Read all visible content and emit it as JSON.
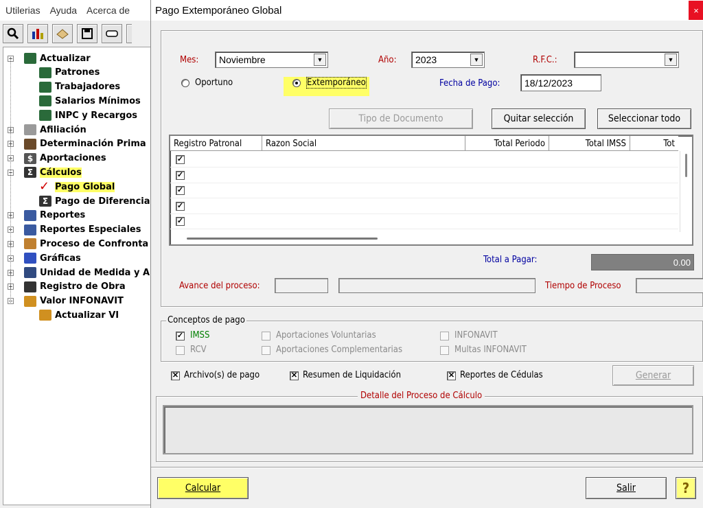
{
  "app": {
    "menu": [
      "Utilerias",
      "Ayuda",
      "Acerca de"
    ],
    "toolbar_icons": [
      "magnifier-icon",
      "chart-icon",
      "tools-icon",
      "save-icon",
      "button-icon",
      "more-icon"
    ],
    "tree": [
      {
        "label": "Actualizar",
        "level": 0,
        "expander": "−",
        "icon": "people-icon",
        "icon_color": "#2a6a3a"
      },
      {
        "label": "Patrones",
        "level": 1,
        "icon": "people-icon",
        "icon_color": "#2a6a3a"
      },
      {
        "label": "Trabajadores",
        "level": 1,
        "icon": "people-icon",
        "icon_color": "#2a6a3a"
      },
      {
        "label": "Salarios Mínimos",
        "level": 1,
        "icon": "people-icon",
        "icon_color": "#2a6a3a"
      },
      {
        "label": "INPC y Recargos",
        "level": 1,
        "icon": "people-icon",
        "icon_color": "#2a6a3a"
      },
      {
        "label": "Afiliación",
        "level": 0,
        "expander": "+",
        "icon": "document-icon",
        "icon_color": "#9a9a9a"
      },
      {
        "label": "Determinación Prima",
        "level": 0,
        "expander": "+",
        "icon": "calculator-icon",
        "icon_color": "#6a4a2a"
      },
      {
        "label": "Aportaciones",
        "level": 0,
        "expander": "+",
        "icon": "dollar-icon",
        "icon_color": "#555555"
      },
      {
        "label": "Cálculos",
        "level": 0,
        "expander": "−",
        "icon": "sigma-icon",
        "icon_color": "#333333",
        "highlight": true
      },
      {
        "label": "Pago Global",
        "level": 1,
        "icon": "checkmark-icon",
        "icon_color": "#d00000",
        "highlight": true
      },
      {
        "label": "Pago de Diferencias",
        "level": 1,
        "icon": "sigma-icon",
        "icon_color": "#333333"
      },
      {
        "label": "Reportes",
        "level": 0,
        "expander": "+",
        "icon": "reports-icon",
        "icon_color": "#3a5aa0"
      },
      {
        "label": "Reportes Especiales",
        "level": 0,
        "expander": "+",
        "icon": "reports-icon",
        "icon_color": "#3a5aa0"
      },
      {
        "label": "Proceso de Confronta",
        "level": 0,
        "expander": "+",
        "icon": "compare-icon",
        "icon_color": "#c08030"
      },
      {
        "label": "Gráficas",
        "level": 0,
        "expander": "+",
        "icon": "bar-chart-icon",
        "icon_color": "#3050c0"
      },
      {
        "label": "Unidad de Medida y A",
        "level": 0,
        "expander": "+",
        "icon": "calculator-icon",
        "icon_color": "#304a80"
      },
      {
        "label": "Registro de Obra",
        "level": 0,
        "expander": "+",
        "icon": "tools-icon",
        "icon_color": "#333333"
      },
      {
        "label": "Valor INFONAVIT",
        "level": 0,
        "expander": "−",
        "icon": "money-bag-icon",
        "icon_color": "#d09020"
      },
      {
        "label": "Actualizar VI",
        "level": 1,
        "icon": "money-bag-icon",
        "icon_color": "#d09020"
      }
    ]
  },
  "dialog": {
    "title": "Pago Extemporáneo Global",
    "close": "×",
    "mes_label": "Mes:",
    "mes_value": "Noviembre",
    "anio_label": "Año:",
    "anio_value": "2023",
    "rfc_label": "R.F.C.:",
    "rfc_value": "",
    "radio_oportuno": "Oportuno",
    "radio_extemporaneo": "Extemporáneo",
    "fecha_label": "Fecha de Pago:",
    "fecha_value": "18/12/2023",
    "btn_tipo_documento": "Tipo de Documento",
    "btn_quitar": "Quitar selección",
    "btn_seleccionar": "Seleccionar todo",
    "grid_columns": [
      "Registro Patronal",
      "Razon Social",
      "Total Periodo",
      "Total IMSS",
      "Tot"
    ],
    "grid_rows_checked": [
      true,
      true,
      true,
      true,
      true
    ],
    "total_label": "Total a Pagar:",
    "total_value": "0.00",
    "avance_label": "Avance del proceso:",
    "tiempo_label": "Tiempo de Proceso",
    "conceptos_title": "Conceptos de pago",
    "conceptos": [
      {
        "label": "IMSS",
        "checked": true,
        "enabled": true
      },
      {
        "label": "Aportaciones Voluntarias",
        "checked": false,
        "enabled": false
      },
      {
        "label": "INFONAVIT",
        "checked": false,
        "enabled": false
      },
      {
        "label": "RCV",
        "checked": false,
        "enabled": false
      },
      {
        "label": "Aportaciones Complementarias",
        "checked": false,
        "enabled": false
      },
      {
        "label": "Multas INFONAVIT",
        "checked": false,
        "enabled": false
      }
    ],
    "chk_archivos": "Archivo(s) de pago",
    "chk_resumen": "Resumen de Liquidación",
    "chk_reportes": "Reportes de Cédulas",
    "btn_generar": "Generar",
    "detalle_title": "Detalle del Proceso de Cálculo",
    "btn_calcular": "Calcular",
    "btn_salir": "Salir",
    "help_glyph": "?"
  },
  "colors": {
    "highlight": "#ffff66",
    "label_red": "#b00000",
    "label_blue": "#0000a0",
    "close_red": "#e81123",
    "total_box": "#808080"
  }
}
